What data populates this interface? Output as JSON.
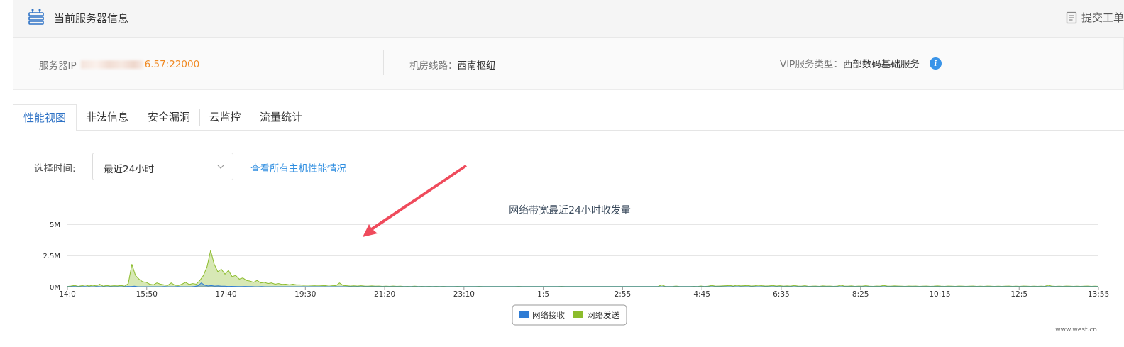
{
  "header": {
    "title": "当前服务器信息",
    "ticket_label": "提交工单"
  },
  "info": {
    "ip_label": "服务器IP",
    "ip_value": "6.57:22000",
    "line_label": "机房线路：",
    "line_value": "西南枢纽",
    "vip_label": "VIP服务类型：",
    "vip_value": "西部数码基础服务",
    "info_icon_glyph": "i"
  },
  "tabs": [
    {
      "label": "性能视图",
      "active": true
    },
    {
      "label": "非法信息",
      "active": false
    },
    {
      "label": "安全漏洞",
      "active": false
    },
    {
      "label": "云监控",
      "active": false
    },
    {
      "label": "流量统计",
      "active": false
    }
  ],
  "filter": {
    "label": "选择时间:",
    "selected": "最近24小时",
    "link": "查看所有主机性能情况"
  },
  "colors": {
    "accent": "#2f73c6",
    "link": "#2f8ee0",
    "ip": "#f08a24",
    "send": "#8cbc2c",
    "receive": "#2f7cd4",
    "annotation_arrow": "#ef4b5c"
  },
  "chart_data": {
    "type": "area",
    "title": "网络带宽最近24小时收发量",
    "y_ticks": [
      "0M",
      "2.5M",
      "5M"
    ],
    "ylim": [
      0,
      5
    ],
    "y_unit": "M",
    "x_ticks": [
      "14:0",
      "15:50",
      "17:40",
      "19:30",
      "21:20",
      "23:10",
      "1:5",
      "2:55",
      "4:45",
      "6:35",
      "8:25",
      "10:15",
      "12:5",
      "13:55"
    ],
    "grid": true,
    "legend_position": "bottom-center",
    "series": [
      {
        "name": "网络接收",
        "color": "#2f7cd4",
        "values": [
          0,
          0,
          0.01,
          0,
          0,
          0.01,
          0,
          0,
          0,
          0.01,
          0,
          0,
          0,
          0,
          0,
          0,
          0,
          0,
          0.02,
          0.01,
          0.04,
          0,
          0,
          0,
          0,
          0,
          0,
          0,
          0,
          0.01,
          0,
          0,
          0,
          0.01,
          0,
          0,
          0,
          0,
          0.02,
          0.08,
          0.3,
          0.12,
          0.06,
          0.09,
          0.05,
          0.07,
          0.04,
          0.04,
          0.02,
          0.03,
          0.02,
          0.01,
          0.01,
          0.02,
          0.01,
          0.01,
          0,
          0,
          0.01,
          0,
          0,
          0,
          0,
          0,
          0,
          0,
          0,
          0,
          0,
          0,
          0,
          0,
          0,
          0,
          0,
          0,
          0,
          0,
          0,
          0,
          0,
          0,
          0,
          0,
          0,
          0,
          0,
          0,
          0,
          0,
          0,
          0,
          0,
          0,
          0,
          0,
          0,
          0,
          0,
          0,
          0,
          0,
          0,
          0,
          0,
          0,
          0,
          0,
          0,
          0,
          0,
          0,
          0,
          0,
          0,
          0,
          0,
          0,
          0,
          0,
          0,
          0,
          0,
          0,
          0,
          0,
          0,
          0,
          0,
          0,
          0,
          0,
          0,
          0,
          0,
          0,
          0,
          0,
          0,
          0,
          0,
          0,
          0,
          0,
          0,
          0,
          0,
          0,
          0,
          0,
          0,
          0,
          0,
          0,
          0,
          0,
          0,
          0,
          0,
          0,
          0,
          0,
          0,
          0,
          0,
          0,
          0,
          0,
          0,
          0,
          0,
          0,
          0,
          0,
          0,
          0,
          0,
          0,
          0,
          0,
          0,
          0,
          0,
          0,
          0,
          0,
          0,
          0,
          0,
          0,
          0,
          0,
          0,
          0,
          0,
          0,
          0,
          0,
          0,
          0,
          0,
          0,
          0,
          0,
          0,
          0,
          0,
          0,
          0,
          0,
          0,
          0,
          0,
          0,
          0,
          0,
          0,
          0,
          0,
          0,
          0,
          0,
          0,
          0,
          0,
          0,
          0,
          0,
          0,
          0,
          0,
          0,
          0,
          0,
          0,
          0,
          0,
          0,
          0,
          0,
          0,
          0,
          0,
          0,
          0,
          0,
          0,
          0,
          0,
          0,
          0,
          0,
          0,
          0,
          0,
          0,
          0,
          0,
          0,
          0,
          0,
          0,
          0,
          0,
          0,
          0,
          0,
          0,
          0,
          0,
          0,
          0,
          0,
          0,
          0,
          0,
          0,
          0,
          0,
          0,
          0,
          0,
          0,
          0,
          0,
          0,
          0,
          0,
          0,
          0,
          0,
          0,
          0,
          0,
          0,
          0,
          0,
          0,
          0,
          0,
          0,
          0,
          0,
          0,
          0,
          0,
          0,
          0,
          0
        ]
      },
      {
        "name": "网络发送",
        "color": "#8cbc2c",
        "values": [
          0.02,
          0.05,
          0.1,
          0.03,
          0.08,
          0.15,
          0.05,
          0.12,
          0.06,
          0.2,
          0.04,
          0.1,
          0.05,
          0.08,
          0.06,
          0.1,
          0.04,
          0.25,
          1.8,
          0.9,
          0.6,
          0.4,
          0.35,
          0.2,
          0.15,
          0.3,
          0.2,
          0.15,
          0.1,
          0.3,
          0.12,
          0.1,
          0.2,
          0.35,
          0.18,
          0.25,
          0.2,
          0.5,
          0.9,
          1.6,
          2.9,
          1.8,
          1.2,
          1.4,
          1.0,
          1.3,
          0.8,
          0.9,
          0.6,
          0.7,
          0.5,
          0.45,
          0.35,
          0.5,
          0.3,
          0.35,
          0.25,
          0.3,
          0.2,
          0.25,
          0.18,
          0.2,
          0.15,
          0.2,
          0.15,
          0.15,
          0.12,
          0.14,
          0.12,
          0.1,
          0.12,
          0.1,
          0.08,
          0.15,
          0.1,
          0.08,
          0.3,
          0.1,
          0.08,
          0.05,
          0.07,
          0.05,
          0.08,
          0.05,
          0.04,
          0.06,
          0.04,
          0.05,
          0.03,
          0.04,
          0.03,
          0.05,
          0.03,
          0.04,
          0.02,
          0.03,
          0.02,
          0.04,
          0.02,
          0.03,
          0.02,
          0.03,
          0.02,
          0.03,
          0.02,
          0.03,
          0.02,
          0.02,
          0.02,
          0.03,
          0.02,
          0.02,
          0.02,
          0.02,
          0.02,
          0.03,
          0.02,
          0.02,
          0.02,
          0.02,
          0.02,
          0.02,
          0.02,
          0.02,
          0.02,
          0.02,
          0.03,
          0.02,
          0.02,
          0.02,
          0.02,
          0.02,
          0.02,
          0.02,
          0.02,
          0.02,
          0.02,
          0.02,
          0.03,
          0.02,
          0.02,
          0.02,
          0.02,
          0.02,
          0.02,
          0.02,
          0.02,
          0.02,
          0.02,
          0.02,
          0.02,
          0.02,
          0.02,
          0.02,
          0.02,
          0.02,
          0.02,
          0.02,
          0.02,
          0.02,
          0.02,
          0.02,
          0.02,
          0.02,
          0.02,
          0.02,
          0.15,
          0.02,
          0.02,
          0.02,
          0.05,
          0.02,
          0.02,
          0.02,
          0.02,
          0.03,
          0.02,
          0.05,
          0.02,
          0.04,
          0.1,
          0.04,
          0.05,
          0.06,
          0.08,
          0.1,
          0.05,
          0.12,
          0.06,
          0.08,
          0.1,
          0.05,
          0.07,
          0.12,
          0.08,
          0.05,
          0.06,
          0.1,
          0.05,
          0.08,
          0.04,
          0.06,
          0.04,
          0.1,
          0.05,
          0.04,
          0.08,
          0.03,
          0.04,
          0.05,
          0.03,
          0.06,
          0.04,
          0.05,
          0.03,
          0.04,
          0.12,
          0.05,
          0.04,
          0.06,
          0.03,
          0.05,
          0.04,
          0.08,
          0.04,
          0.03,
          0.05,
          0.04,
          0.1,
          0.05,
          0.04,
          0.06,
          0.05,
          0.04,
          0.03,
          0.05,
          0.04,
          0.05,
          0.03,
          0.04,
          0.05,
          0.03,
          0.04,
          0.06,
          0.04,
          0.03,
          0.05,
          0.04,
          0.03,
          0.05,
          0.04,
          0.03,
          0.04,
          0.05,
          0.03,
          0.04,
          0.03,
          0.05,
          0.04,
          0.03,
          0.04,
          0.03,
          0.04,
          0.05,
          0.03,
          0.04,
          0.03,
          0.05,
          0.04,
          0.03,
          0.04,
          0.03,
          0.04,
          0.03,
          0.12,
          0.04,
          0.03,
          0.04,
          0.03,
          0.05,
          0.04,
          0.03,
          0.04,
          0.03,
          0.04,
          0.05,
          0.03,
          0.04,
          0.03
        ]
      }
    ]
  },
  "watermark": "www.west.cn"
}
